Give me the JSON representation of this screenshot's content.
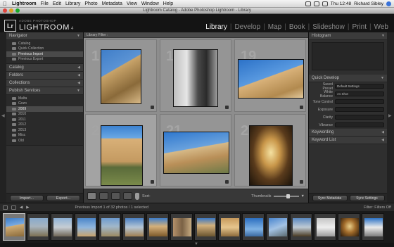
{
  "menubar": {
    "apple": "",
    "items": [
      "Lightroom",
      "File",
      "Edit",
      "Library",
      "Photo",
      "Metadata",
      "View",
      "Window",
      "Help"
    ],
    "clock": "Thu 12:48",
    "user": "Richard Sibley"
  },
  "window": {
    "title": "Lightroom Catalog - Adobe Photoshop Lightroom - Library"
  },
  "identity": {
    "sub": "ADOBE PHOTOSHOP",
    "name": "LIGHTROOM",
    "version": "4"
  },
  "modules": [
    {
      "label": "Library",
      "active": true
    },
    {
      "label": "Develop",
      "active": false
    },
    {
      "label": "Map",
      "active": false
    },
    {
      "label": "Book",
      "active": false
    },
    {
      "label": "Slideshow",
      "active": false
    },
    {
      "label": "Print",
      "active": false
    },
    {
      "label": "Web",
      "active": false
    }
  ],
  "left": {
    "navigator": "Navigator",
    "catalog_rows": [
      "Catalog",
      "Quick Collection",
      "Previous Import",
      "Previous Export"
    ],
    "sections": [
      "Catalog",
      "Folders",
      "Collections",
      "Publish Services"
    ],
    "folder_rows": [
      "Malta",
      "Gozo",
      "2009",
      "2010",
      "2011",
      "2012",
      "2013",
      "Misc",
      "Old"
    ],
    "import_label": "Import...",
    "export_label": "Export..."
  },
  "center": {
    "filter": "Library Filter :"
  },
  "grid_colors": {
    "sky": "#3f7ec9",
    "stone": "#c9a46a",
    "shadow": "#3a3a3a"
  },
  "toolbar": {
    "sort": "Sort:",
    "thumbs": "Thumbnails"
  },
  "right": {
    "histogram": "Histogram",
    "quick_develop": "Quick Develop",
    "saved_preset": "Saved Preset",
    "white_balance": "White Balance",
    "tone_control": "Tone Control",
    "exposure": "Exposure",
    "clarity": "Clarity",
    "vibrance": "Vibrance",
    "keywording": "Keywording",
    "keyword_list": "Keyword List",
    "sync_meta": "Sync Metadata",
    "sync_settings": "Sync Settings",
    "preset_value": "Default Settings",
    "wb_value": "As Shot"
  },
  "filmstrip": {
    "path": "Previous Import   1 of 32 photos / 1 selected",
    "filter": "Filter:  Filters Off"
  }
}
